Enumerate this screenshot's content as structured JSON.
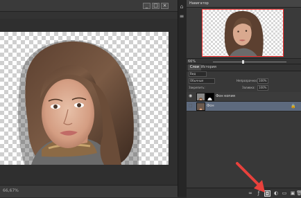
{
  "navigator": {
    "title": "Навигатор",
    "zoom": "66%"
  },
  "layers": {
    "tabs": [
      {
        "label": "Слои"
      },
      {
        "label": "История"
      }
    ],
    "kind_label": "Вид",
    "blend_mode": "Обычные",
    "opacity_label": "Непрозрачность:",
    "opacity_value": "100%",
    "lock_label": "Закрепить:",
    "fill_label": "Заливка:",
    "fill_value": "100%",
    "items": [
      {
        "name": "Фон копия",
        "visible": true,
        "selected": false,
        "has_mask": true
      },
      {
        "name": "Фон",
        "visible": false,
        "selected": true,
        "has_mask": false
      }
    ],
    "footer_icons": [
      "link-icon",
      "fx-icon",
      "add-mask-icon",
      "adjustment-icon",
      "group-icon",
      "new-layer-icon",
      "trash-icon"
    ]
  },
  "document": {
    "zoom_status": "66,67%"
  },
  "colors": {
    "accent_arrow": "#e8413c",
    "selection_border": "#ff3030"
  }
}
